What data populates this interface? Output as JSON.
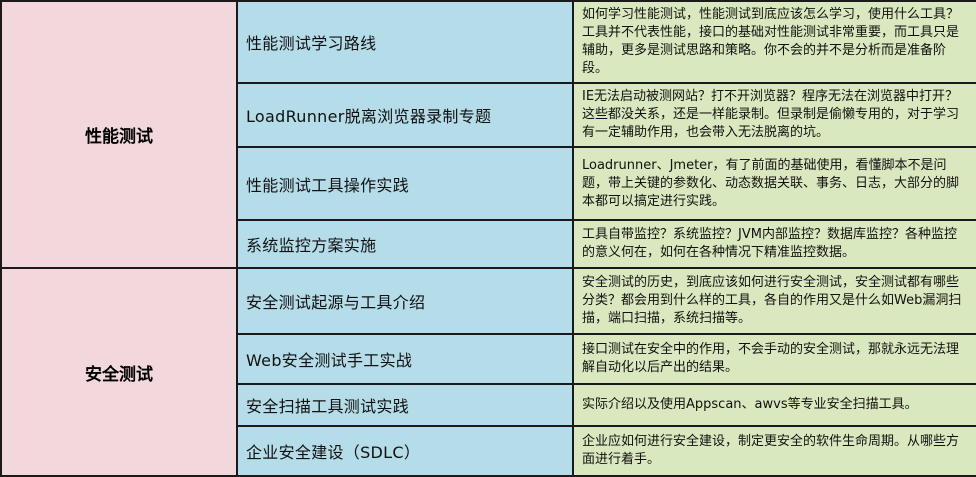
{
  "sections": [
    {
      "category": "性能测试",
      "rows": [
        {
          "topic": "性能测试学习路线",
          "description": "如何学习性能测试，性能测试到底应该怎么学习，使用什么工具？工具并不代表性能，接口的基础对性能测试非常重要，而工具只是辅助，更多是测试思路和策略。你不会的并不是分析而是准备阶段。"
        },
        {
          "topic": "LoadRunner脱离浏览器录制专题",
          "description": "IE无法启动被测网站？打不开浏览器？程序无法在浏览器中打开？这些都没关系，还是一样能录制。但录制是偷懒专用的，对于学习有一定辅助作用，也会带入无法脱离的坑。"
        },
        {
          "topic": "性能测试工具操作实践",
          "description": "Loadrunner、Jmeter，有了前面的基础使用，看懂脚本不是问题，带上关键的参数化、动态数据关联、事务、日志，大部分的脚本都可以搞定进行实践。"
        },
        {
          "topic": "系统监控方案实施",
          "description": "工具自带监控？系统监控？JVM内部监控？数据库监控？各种监控的意义何在，如何在各种情况下精准监控数据。"
        }
      ]
    },
    {
      "category": "安全测试",
      "rows": [
        {
          "topic": "安全测试起源与工具介绍",
          "description": "安全测试的历史，到底应该如何进行安全测试，安全测试都有哪些分类？都会用到什么样的工具，各自的作用又是什么如Web漏洞扫描，端口扫描，系统扫描等。"
        },
        {
          "topic": "Web安全测试手工实战",
          "description": "接口测试在安全中的作用，不会手动的安全测试，那就永远无法理解自动化以后产出的结果。"
        },
        {
          "topic": "安全扫描工具测试实践",
          "description": "实际介绍以及使用Appscan、awvs等专业安全扫描工具。"
        },
        {
          "topic": "企业安全建设（SDLC）",
          "description": "企业应如何进行安全建设，制定更安全的软件生命周期。从哪些方面进行着手。"
        }
      ]
    }
  ]
}
